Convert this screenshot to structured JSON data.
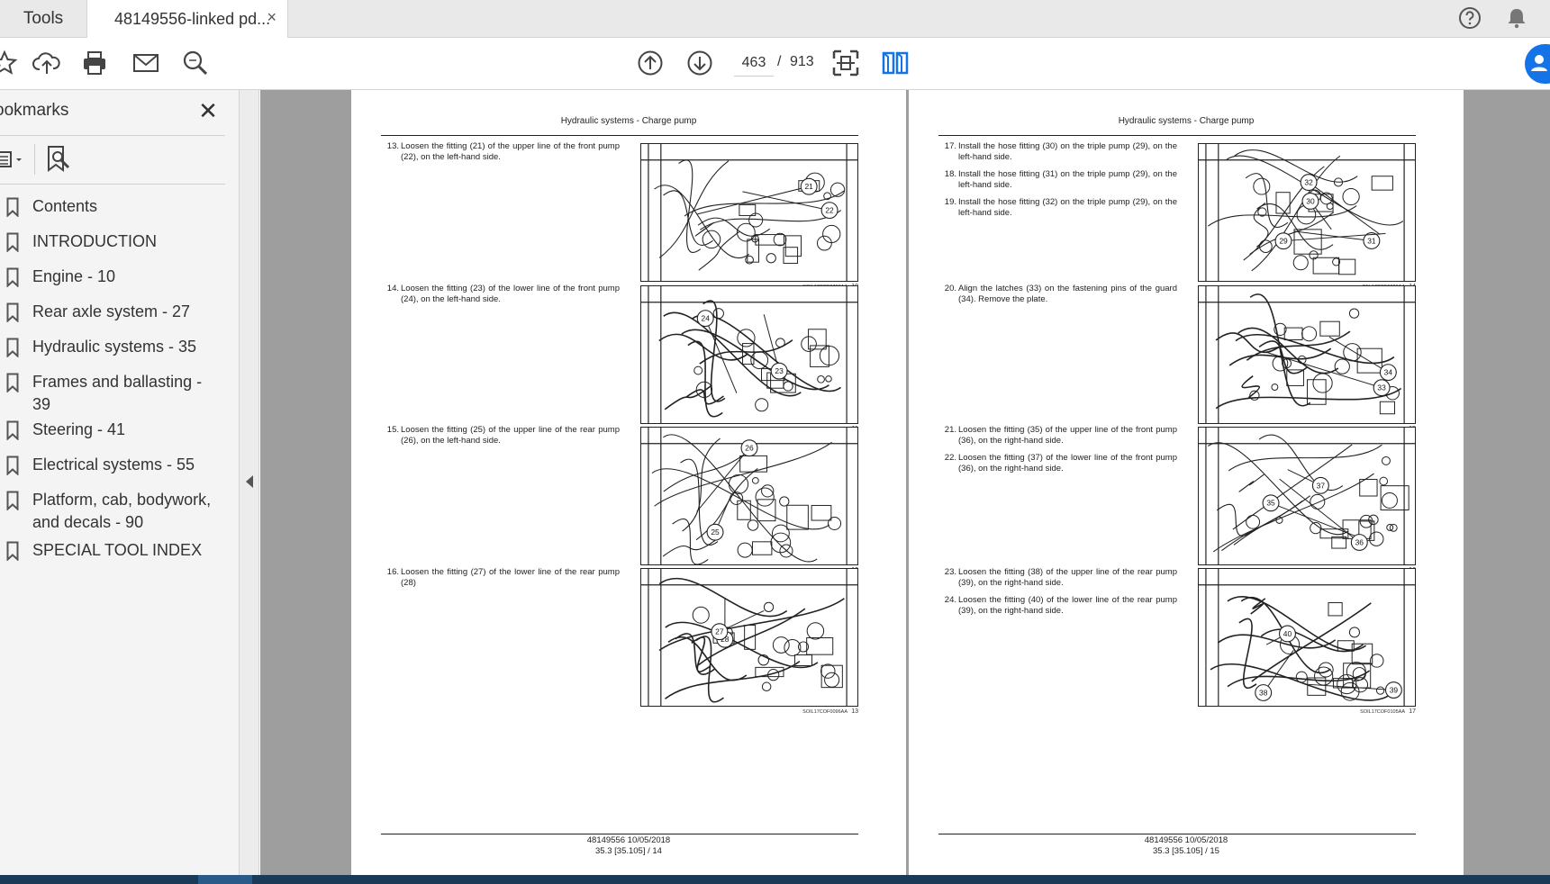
{
  "tabs": {
    "tools_label": "Tools",
    "doc_label": "48149556-linked pd...",
    "close_glyph": "×"
  },
  "toolbar": {
    "current_page": "463",
    "page_sep": "/",
    "total_pages": "913"
  },
  "sidebar": {
    "title": "ookmarks",
    "close_glyph": "✕",
    "items": [
      {
        "label": "Contents"
      },
      {
        "label": "INTRODUCTION"
      },
      {
        "label": "Engine - 10"
      },
      {
        "label": "Rear axle system - 27"
      },
      {
        "label": "Hydraulic systems - 35"
      },
      {
        "label": "Frames and ballasting - 39"
      },
      {
        "label": "Steering - 41"
      },
      {
        "label": "Electrical systems - 55"
      },
      {
        "label": "Platform, cab, bodywork, and decals - 90"
      },
      {
        "label": "SPECIAL TOOL INDEX"
      }
    ]
  },
  "document": {
    "left_page": {
      "header": "Hydraulic systems - Charge pump",
      "steps": [
        {
          "num": "13.",
          "text": "Loosen the fitting (21) of the upper line of the front pump (22), on the left-hand side."
        },
        {
          "num": "14.",
          "text": "Loosen the fitting (23) of the lower line of the front pump (24), on the left-hand side."
        },
        {
          "num": "15.",
          "text": "Loosen the fitting (25) of the upper line of the rear pump (26), on the left-hand side."
        },
        {
          "num": "16.",
          "text": "Loosen the fitting (27) of the lower line of the rear pump (28)"
        }
      ],
      "figures": [
        {
          "code": "SOIL17COF0096AA",
          "n": "10",
          "callouts": [
            "22",
            "21"
          ]
        },
        {
          "code": "SOIL17COF0098AA",
          "n": "11",
          "callouts": [
            "24",
            "23"
          ]
        },
        {
          "code": "SOIL17COF0096AA",
          "n": "12",
          "callouts": [
            "25",
            "26"
          ]
        },
        {
          "code": "SOIL17COF0096AA",
          "n": "13",
          "callouts": [
            "28",
            "27"
          ]
        }
      ],
      "footer_line1": "48149556 10/05/2018",
      "footer_line2": "35.3 [35.105] / 14"
    },
    "right_page": {
      "header": "Hydraulic systems - Charge pump",
      "steps": [
        {
          "num": "17.",
          "text": "Install the hose fitting (30) on the triple pump (29), on the left-hand side."
        },
        {
          "num": "18.",
          "text": "Install the hose fitting (31) on the triple pump (29), on the left-hand side."
        },
        {
          "num": "19.",
          "text": "Install the hose fitting (32) on the triple pump (29), on the left-hand side."
        },
        {
          "num": "20.",
          "text": "Align the latches (33) on the fastening pins of the guard (34). Remove the plate."
        },
        {
          "num": "21.",
          "text": "Loosen the fitting (35) of the upper line of the front pump (36), on the right-hand side."
        },
        {
          "num": "22.",
          "text": "Loosen the fitting (37) of the lower line of the front pump (36), on the right-hand side."
        },
        {
          "num": "23.",
          "text": "Loosen the fitting (38) of the upper line of the rear pump (39), on the right-hand side."
        },
        {
          "num": "24.",
          "text": "Loosen the fitting (40) of the lower line of the rear pump (39), on the right-hand side."
        }
      ],
      "figures": [
        {
          "code": "PIIL17COF0096AA",
          "n": "14",
          "callouts": [
            "32",
            "31",
            "29",
            "30"
          ]
        },
        {
          "code": "SOIL17COF0096AA",
          "n": "15",
          "callouts": [
            "33",
            "34"
          ]
        },
        {
          "code": "SOIL17COF0105AA",
          "n": "16",
          "callouts": [
            "37",
            "35",
            "36"
          ]
        },
        {
          "code": "SOIL17COF0105AA",
          "n": "17",
          "callouts": [
            "39",
            "40",
            "38"
          ]
        }
      ],
      "footer_line1": "48149556 10/05/2018",
      "footer_line2": "35.3 [35.105] / 15"
    }
  },
  "colors": {
    "accent": "#1473e6",
    "canvas": "#9e9e9e",
    "sidebar_bg": "#f4f4f4"
  }
}
